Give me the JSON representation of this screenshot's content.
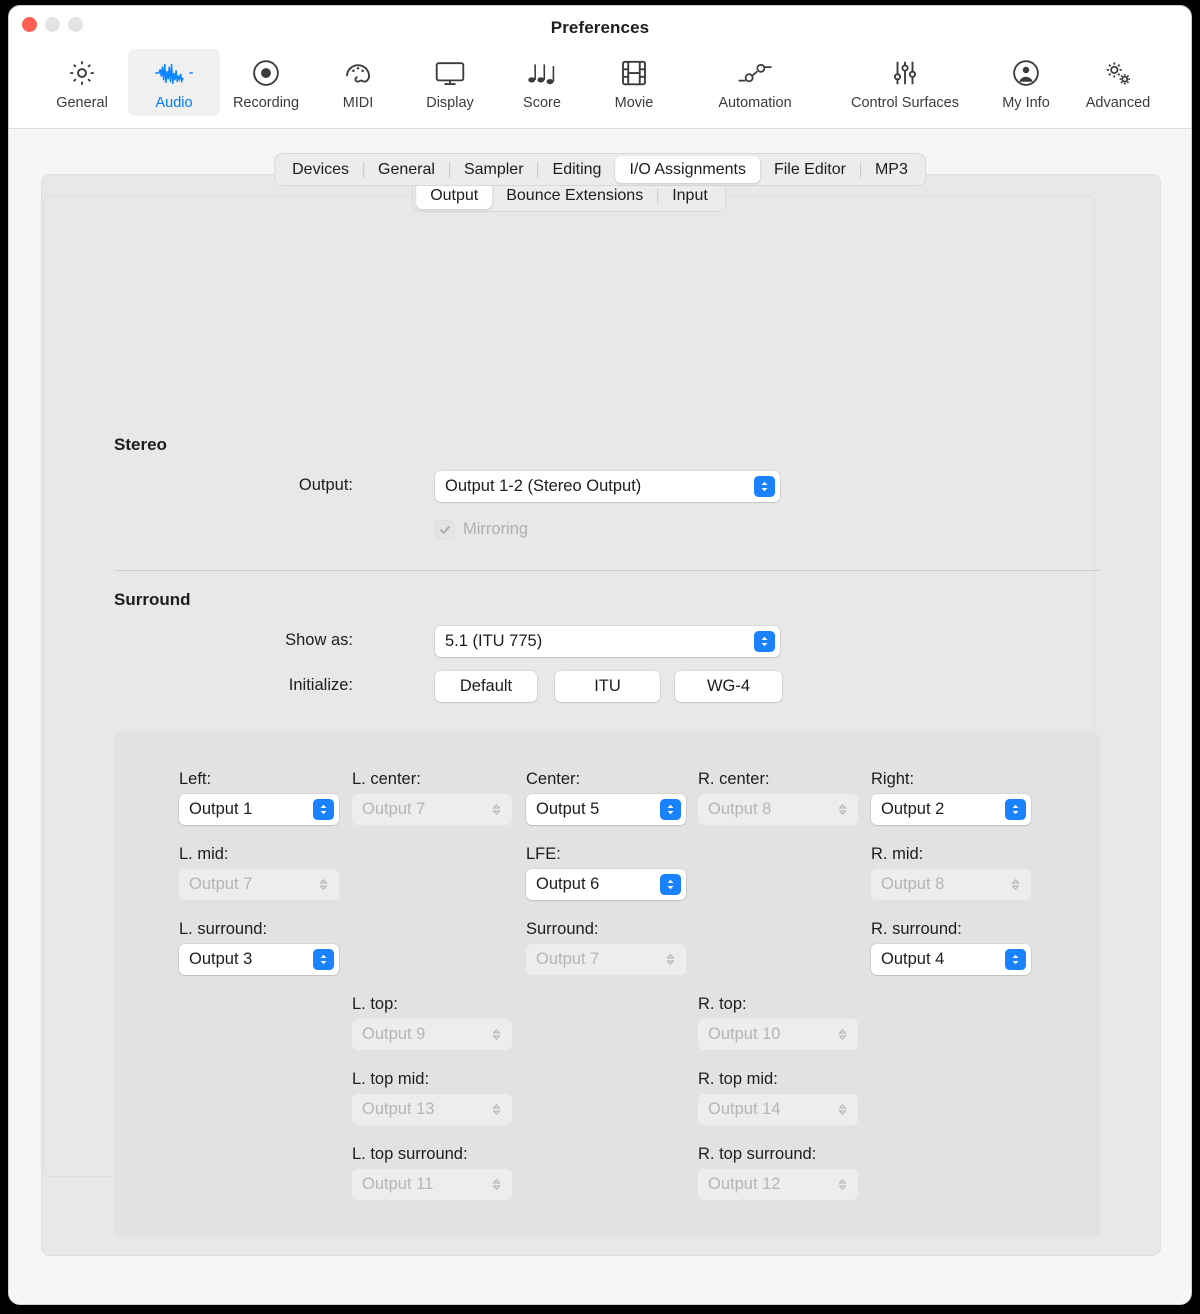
{
  "window": {
    "title": "Preferences",
    "traffic_lights": [
      "close-button",
      "minimize-button",
      "zoom-button"
    ]
  },
  "toolbar": {
    "items": [
      {
        "label": "General",
        "icon": "gear-icon",
        "selected": false
      },
      {
        "label": "Audio",
        "icon": "waveform-icon",
        "selected": true
      },
      {
        "label": "Recording",
        "icon": "record-circle-icon",
        "selected": false
      },
      {
        "label": "MIDI",
        "icon": "midi-plug-icon",
        "selected": false
      },
      {
        "label": "Display",
        "icon": "monitor-icon",
        "selected": false
      },
      {
        "label": "Score",
        "icon": "music-notes-icon",
        "selected": false
      },
      {
        "label": "Movie",
        "icon": "filmstrip-icon",
        "selected": false
      },
      {
        "label": "Automation",
        "icon": "automation-node-icon",
        "selected": false
      },
      {
        "label": "Control Surfaces",
        "icon": "sliders-icon",
        "selected": false
      },
      {
        "label": "My Info",
        "icon": "person-circle-icon",
        "selected": false
      },
      {
        "label": "Advanced",
        "icon": "double-gear-icon",
        "selected": false
      }
    ]
  },
  "tabs": {
    "items": [
      {
        "label": "Devices",
        "active": false
      },
      {
        "label": "General",
        "active": false
      },
      {
        "label": "Sampler",
        "active": false
      },
      {
        "label": "Editing",
        "active": false
      },
      {
        "label": "I/O Assignments",
        "active": true
      },
      {
        "label": "File Editor",
        "active": false
      },
      {
        "label": "MP3",
        "active": false
      }
    ]
  },
  "subtabs": {
    "items": [
      {
        "label": "Output",
        "active": true
      },
      {
        "label": "Bounce Extensions",
        "active": false
      },
      {
        "label": "Input",
        "active": false
      }
    ]
  },
  "stereo": {
    "heading": "Stereo",
    "output_label": "Output:",
    "output_value": "Output 1-2 (Stereo Output)",
    "mirroring_label": "Mirroring",
    "mirroring_checked": true,
    "mirroring_enabled": false
  },
  "surround": {
    "heading": "Surround",
    "show_as_label": "Show as:",
    "show_as_value": "5.1 (ITU 775)",
    "initialize_label": "Initialize:",
    "initialize_buttons": [
      "Default",
      "ITU",
      "WG-4"
    ],
    "channels": [
      {
        "label": "Left:",
        "value": "Output 1",
        "enabled": true
      },
      {
        "label": "L. center:",
        "value": "Output 7",
        "enabled": false
      },
      {
        "label": "Center:",
        "value": "Output 5",
        "enabled": true
      },
      {
        "label": "R. center:",
        "value": "Output 8",
        "enabled": false
      },
      {
        "label": "Right:",
        "value": "Output 2",
        "enabled": true
      },
      {
        "label": "L. mid:",
        "value": "Output 7",
        "enabled": false
      },
      {
        "label": "LFE:",
        "value": "Output 6",
        "enabled": true
      },
      {
        "label": "R. mid:",
        "value": "Output 8",
        "enabled": false
      },
      {
        "label": "L. surround:",
        "value": "Output 3",
        "enabled": true
      },
      {
        "label": "Surround:",
        "value": "Output 7",
        "enabled": false
      },
      {
        "label": "R. surround:",
        "value": "Output 4",
        "enabled": true
      },
      {
        "label": "L. top:",
        "value": "Output 9",
        "enabled": false
      },
      {
        "label": "R. top:",
        "value": "Output 10",
        "enabled": false
      },
      {
        "label": "L. top mid:",
        "value": "Output 13",
        "enabled": false
      },
      {
        "label": "R. top mid:",
        "value": "Output 14",
        "enabled": false
      },
      {
        "label": "L. top surround:",
        "value": "Output 11",
        "enabled": false
      },
      {
        "label": "R. top surround:",
        "value": "Output 12",
        "enabled": false
      }
    ]
  },
  "colors": {
    "accent": "#1a82ff",
    "selected_text": "#007aff",
    "close_button": "#ff5f52",
    "window_bg": "#f6f6f6",
    "panel_bg": "#e8e8e8",
    "grid_panel_bg": "#e2e2e2",
    "disabled_text": "#b5b5b5"
  }
}
